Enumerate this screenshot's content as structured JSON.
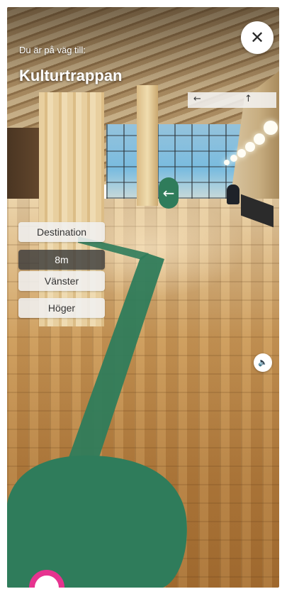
{
  "header": {
    "subtitle": "Du är på väg till:",
    "destination_name": "Kulturtrappan",
    "close_icon": "close-icon"
  },
  "background_sign": {
    "left_arrow": "←",
    "up_arrow": "↑"
  },
  "ar": {
    "turn_arrow_icon": "arrow-left-icon",
    "turn_arrow_glyph": "←",
    "path_color": "#2f7c5b"
  },
  "controls": {
    "destination_label": "Destination",
    "distance": "8m",
    "left_label": "Vänster",
    "right_label": "Höger"
  },
  "sound": {
    "icon": "speaker-icon",
    "glyph": "🔈"
  },
  "colors": {
    "accent": "#e6338f",
    "path_green": "#2f7c5b"
  }
}
